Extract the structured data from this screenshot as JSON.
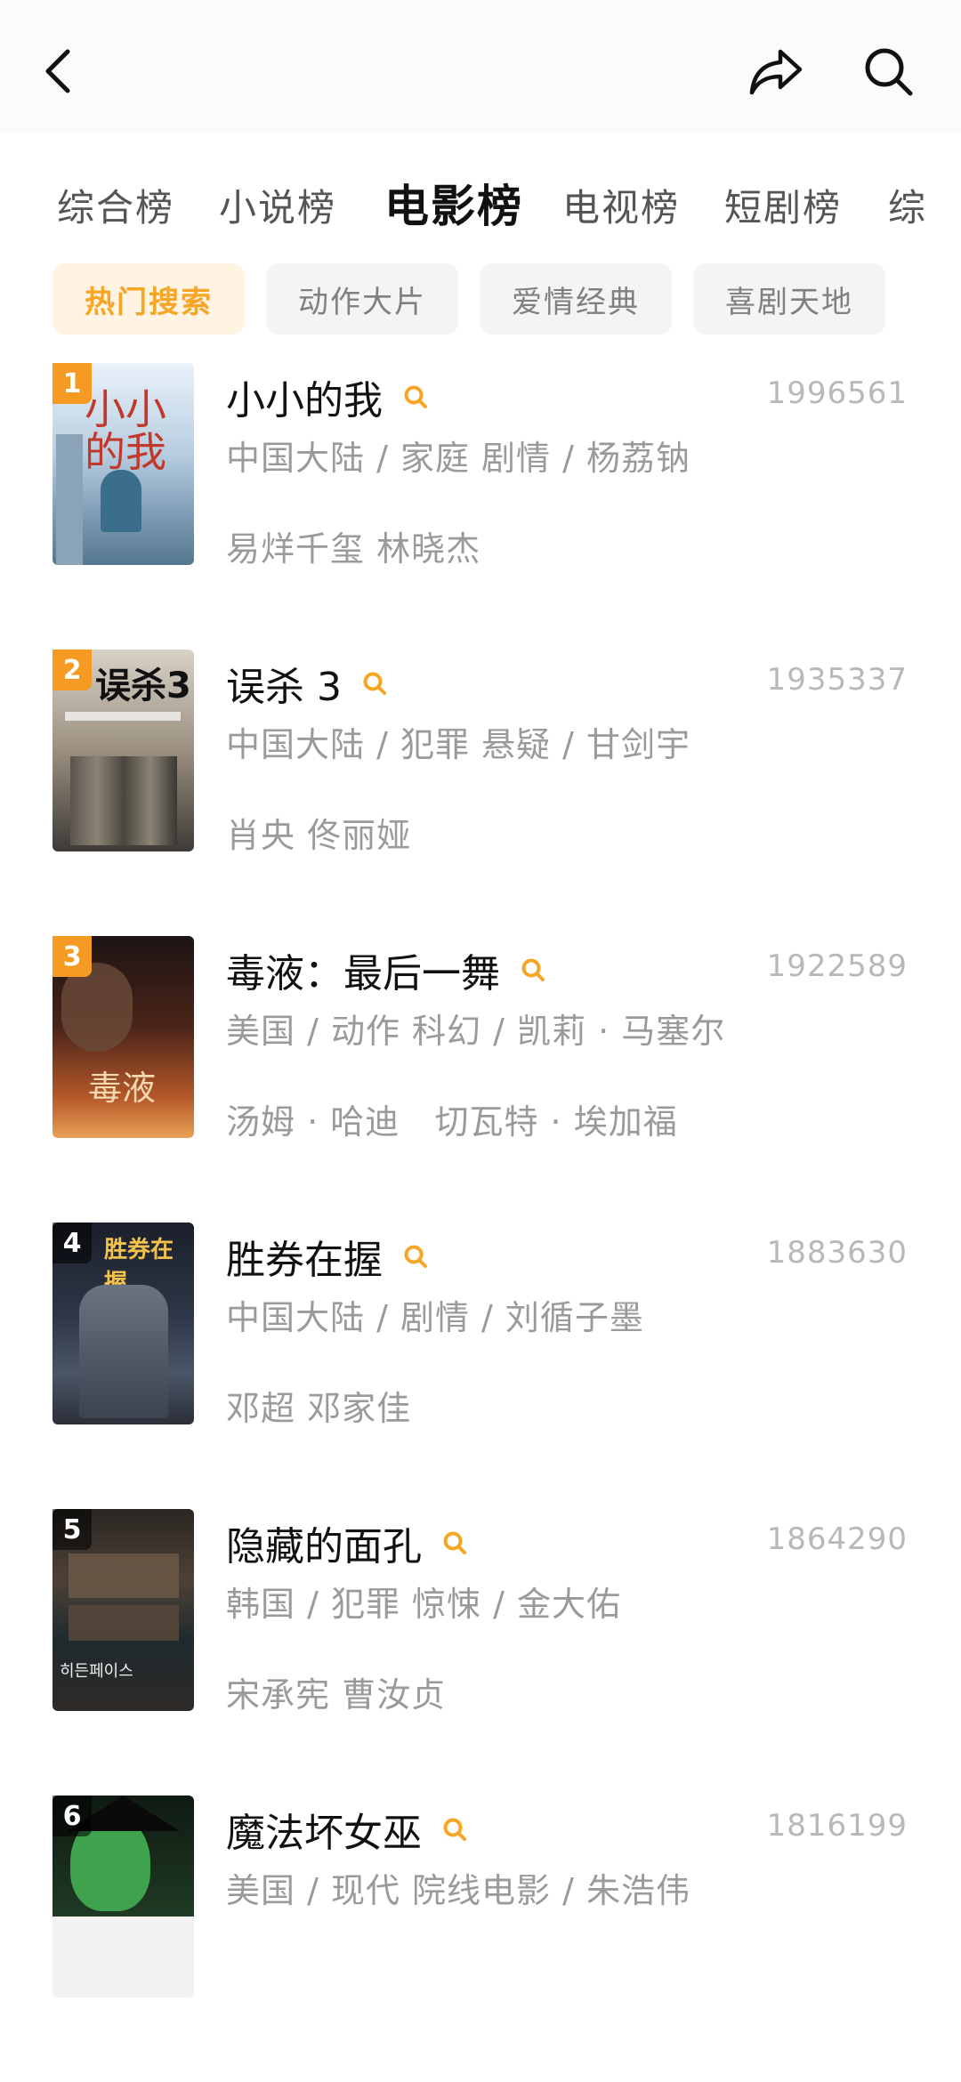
{
  "nav": {
    "back": "back-icon",
    "share": "share-icon",
    "search": "search-icon"
  },
  "tabs": [
    "综合榜",
    "小说榜",
    "电影榜",
    "电视榜",
    "短剧榜",
    "综"
  ],
  "active_tab": "电影榜",
  "chips": [
    "热门搜索",
    "动作大片",
    "爱情经典",
    "喜剧天地"
  ],
  "active_chip": "热门搜索",
  "colors": {
    "accent": "#f59a23",
    "chip_active_bg": "#fff3e3",
    "chip_bg": "#f4f4f4",
    "muted": "#9a9a9a"
  },
  "items": [
    {
      "rank": "1",
      "title": "小小的我",
      "count": "1996561",
      "meta": "中国大陆 / 家庭 剧情 / 杨荔钠",
      "cast": "易烊千玺 林晓杰",
      "poster_text": "小小的我"
    },
    {
      "rank": "2",
      "title": "误杀 3",
      "count": "1935337",
      "meta": "中国大陆 / 犯罪 悬疑 / 甘剑宇",
      "cast": "肖央 佟丽娅",
      "poster_text": "误杀3"
    },
    {
      "rank": "3",
      "title": "毒液：最后一舞",
      "count": "1922589",
      "meta": "美国 / 动作 科幻 / 凯莉 · 马塞尔",
      "cast": "汤姆 · 哈迪   切瓦特 · 埃加福",
      "poster_text": "毒液"
    },
    {
      "rank": "4",
      "title": "胜券在握",
      "count": "1883630",
      "meta": "中国大陆 / 剧情 / 刘循子墨",
      "cast": "邓超 邓家佳",
      "poster_text": "胜券在握"
    },
    {
      "rank": "5",
      "title": "隐藏的面孔",
      "count": "1864290",
      "meta": "韩国 / 犯罪 惊悚 / 金大佑",
      "cast": "宋承宪 曹汝贞",
      "poster_text": "히든페이스"
    },
    {
      "rank": "6",
      "title": "魔法坏女巫",
      "count": "1816199",
      "meta": "美国 / 现代 院线电影 / 朱浩伟",
      "cast": "",
      "poster_text": ""
    }
  ]
}
